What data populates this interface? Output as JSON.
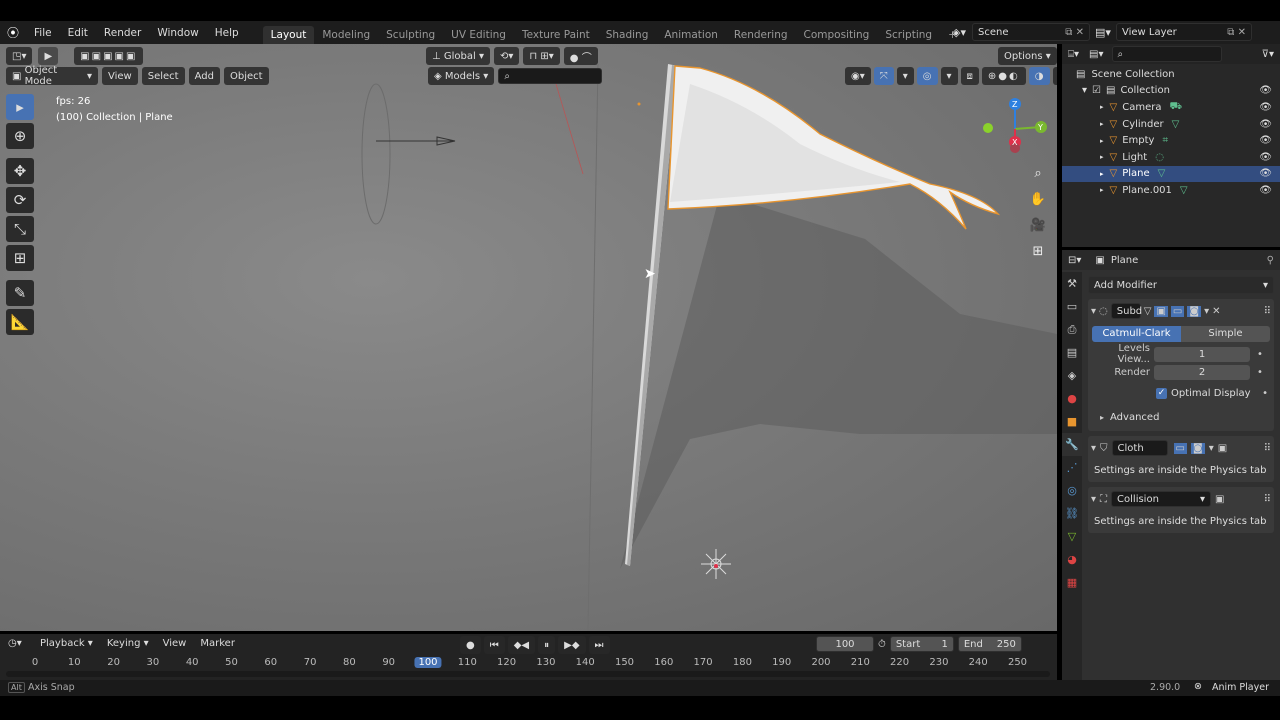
{
  "menubar": {
    "items": [
      "File",
      "Edit",
      "Render",
      "Window",
      "Help"
    ],
    "workspaces": [
      "Layout",
      "Modeling",
      "Sculpting",
      "UV Editing",
      "Texture Paint",
      "Shading",
      "Animation",
      "Rendering",
      "Compositing",
      "Scripting",
      "+"
    ],
    "active_workspace": "Layout",
    "scene": "Scene",
    "view_layer": "View Layer"
  },
  "viewport": {
    "mode": "Object Mode",
    "menus": [
      "View",
      "Select",
      "Add",
      "Object"
    ],
    "transform_orientation": "Global",
    "models_dropdown": "Models",
    "options_label": "Options",
    "overlay_fps": "fps: 26",
    "overlay_context": "(100) Collection | Plane",
    "gizmo_axes": {
      "x": "X",
      "y": "Y",
      "z": "Z"
    }
  },
  "outliner": {
    "root": "Scene Collection",
    "collection": "Collection",
    "items": [
      {
        "name": "Camera",
        "icon": "camera-icon",
        "selected": false
      },
      {
        "name": "Cylinder",
        "icon": "mesh-icon",
        "selected": false
      },
      {
        "name": "Empty",
        "icon": "empty-icon",
        "selected": false
      },
      {
        "name": "Light",
        "icon": "light-icon",
        "selected": false
      },
      {
        "name": "Plane",
        "icon": "mesh-icon",
        "selected": true
      },
      {
        "name": "Plane.001",
        "icon": "mesh-icon",
        "selected": false
      }
    ]
  },
  "properties": {
    "object_name": "Plane",
    "add_modifier": "Add Modifier",
    "subdivision": {
      "name": "Subd",
      "algo_options": [
        "Catmull-Clark",
        "Simple"
      ],
      "active_algo": "Catmull-Clark",
      "levels_viewport_label": "Levels View...",
      "levels_viewport_value": "1",
      "render_label": "Render",
      "render_value": "2",
      "optimal_display_label": "Optimal Display",
      "advanced_label": "Advanced"
    },
    "cloth": {
      "name": "Cloth",
      "note": "Settings are inside the Physics tab"
    },
    "collision": {
      "name": "Collision",
      "note": "Settings are inside the Physics tab"
    }
  },
  "timeline": {
    "menus": [
      "Playback",
      "Keying",
      "View",
      "Marker"
    ],
    "current_frame": "100",
    "start_label": "Start",
    "start_value": "1",
    "end_label": "End",
    "end_value": "250",
    "ruler": [
      "0",
      "10",
      "20",
      "30",
      "40",
      "50",
      "60",
      "70",
      "80",
      "90",
      "100",
      "110",
      "120",
      "130",
      "140",
      "150",
      "160",
      "170",
      "180",
      "190",
      "200",
      "210",
      "220",
      "230",
      "240",
      "250"
    ]
  },
  "statusbar": {
    "hint_key": "Alt",
    "hint": "Axis Snap",
    "version": "2.90.0",
    "app_label": "Anim Player"
  },
  "colors": {
    "accent": "#4772b3",
    "selection": "#334d80",
    "outline": "#e8952f",
    "x_axis": "#e0304a",
    "y_axis": "#7ab82f",
    "z_axis": "#2e80e0"
  }
}
